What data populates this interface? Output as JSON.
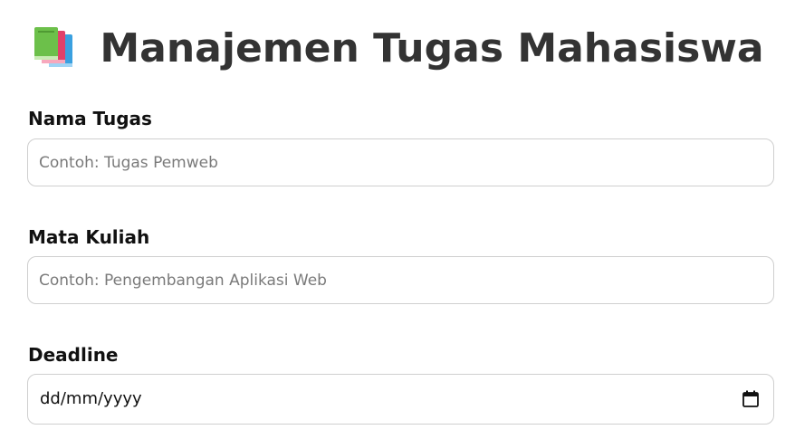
{
  "header": {
    "icon": "books-icon",
    "title": "Manajemen Tugas Mahasiswa"
  },
  "form": {
    "nama_tugas": {
      "label": "Nama Tugas",
      "placeholder": "Contoh: Tugas Pemweb",
      "value": ""
    },
    "mata_kuliah": {
      "label": "Mata Kuliah",
      "placeholder": "Contoh: Pengembangan Aplikasi Web",
      "value": ""
    },
    "deadline": {
      "label": "Deadline",
      "value": "dd/mm/yyyy",
      "icon": "calendar-icon"
    }
  },
  "colors": {
    "title": "#333333",
    "input_border": "#cfcfcf",
    "placeholder": "#7a7a7a"
  }
}
